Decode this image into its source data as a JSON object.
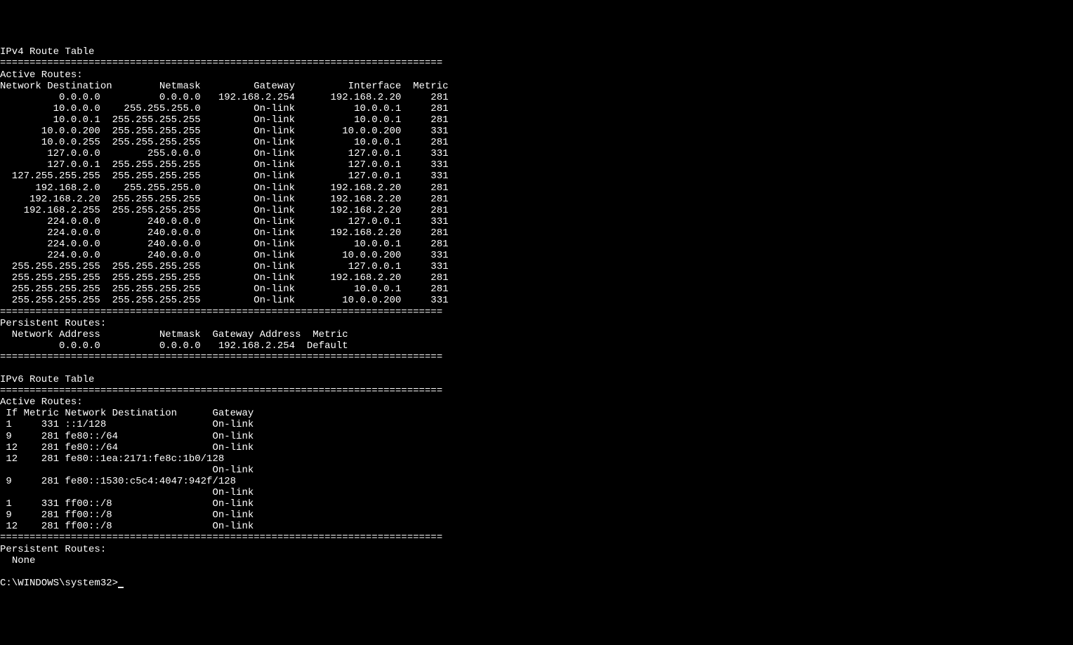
{
  "separator_short": "===========================================================================",
  "ipv4": {
    "title": "IPv4 Route Table",
    "active_header": "Active Routes:",
    "columns": {
      "network_destination": "Network Destination",
      "netmask": "Netmask",
      "gateway": "Gateway",
      "interface": "Interface",
      "metric": "Metric"
    },
    "routes": [
      {
        "dst": "0.0.0.0",
        "mask": "0.0.0.0",
        "gw": "192.168.2.254",
        "if": "192.168.2.20",
        "metric": "281"
      },
      {
        "dst": "10.0.0.0",
        "mask": "255.255.255.0",
        "gw": "On-link",
        "if": "10.0.0.1",
        "metric": "281"
      },
      {
        "dst": "10.0.0.1",
        "mask": "255.255.255.255",
        "gw": "On-link",
        "if": "10.0.0.1",
        "metric": "281"
      },
      {
        "dst": "10.0.0.200",
        "mask": "255.255.255.255",
        "gw": "On-link",
        "if": "10.0.0.200",
        "metric": "331"
      },
      {
        "dst": "10.0.0.255",
        "mask": "255.255.255.255",
        "gw": "On-link",
        "if": "10.0.0.1",
        "metric": "281"
      },
      {
        "dst": "127.0.0.0",
        "mask": "255.0.0.0",
        "gw": "On-link",
        "if": "127.0.0.1",
        "metric": "331"
      },
      {
        "dst": "127.0.0.1",
        "mask": "255.255.255.255",
        "gw": "On-link",
        "if": "127.0.0.1",
        "metric": "331"
      },
      {
        "dst": "127.255.255.255",
        "mask": "255.255.255.255",
        "gw": "On-link",
        "if": "127.0.0.1",
        "metric": "331"
      },
      {
        "dst": "192.168.2.0",
        "mask": "255.255.255.0",
        "gw": "On-link",
        "if": "192.168.2.20",
        "metric": "281"
      },
      {
        "dst": "192.168.2.20",
        "mask": "255.255.255.255",
        "gw": "On-link",
        "if": "192.168.2.20",
        "metric": "281"
      },
      {
        "dst": "192.168.2.255",
        "mask": "255.255.255.255",
        "gw": "On-link",
        "if": "192.168.2.20",
        "metric": "281"
      },
      {
        "dst": "224.0.0.0",
        "mask": "240.0.0.0",
        "gw": "On-link",
        "if": "127.0.0.1",
        "metric": "331"
      },
      {
        "dst": "224.0.0.0",
        "mask": "240.0.0.0",
        "gw": "On-link",
        "if": "192.168.2.20",
        "metric": "281"
      },
      {
        "dst": "224.0.0.0",
        "mask": "240.0.0.0",
        "gw": "On-link",
        "if": "10.0.0.1",
        "metric": "281"
      },
      {
        "dst": "224.0.0.0",
        "mask": "240.0.0.0",
        "gw": "On-link",
        "if": "10.0.0.200",
        "metric": "331"
      },
      {
        "dst": "255.255.255.255",
        "mask": "255.255.255.255",
        "gw": "On-link",
        "if": "127.0.0.1",
        "metric": "331"
      },
      {
        "dst": "255.255.255.255",
        "mask": "255.255.255.255",
        "gw": "On-link",
        "if": "192.168.2.20",
        "metric": "281"
      },
      {
        "dst": "255.255.255.255",
        "mask": "255.255.255.255",
        "gw": "On-link",
        "if": "10.0.0.1",
        "metric": "281"
      },
      {
        "dst": "255.255.255.255",
        "mask": "255.255.255.255",
        "gw": "On-link",
        "if": "10.0.0.200",
        "metric": "331"
      }
    ],
    "persistent_header": "Persistent Routes:",
    "persistent_columns": {
      "network_address": "Network Address",
      "netmask": "Netmask",
      "gateway_address": "Gateway Address",
      "metric": "Metric"
    },
    "persistent_routes": [
      {
        "addr": "0.0.0.0",
        "mask": "0.0.0.0",
        "gw": "192.168.2.254",
        "metric": "Default"
      }
    ]
  },
  "ipv6": {
    "title": "IPv6 Route Table",
    "active_header": "Active Routes:",
    "columns": {
      "if": "If",
      "metric": "Metric",
      "network_destination": "Network Destination",
      "gateway": "Gateway"
    },
    "routes": [
      {
        "if": "1",
        "metric": "331",
        "dst": "::1/128",
        "gw": "On-link",
        "wrap": false
      },
      {
        "if": "9",
        "metric": "281",
        "dst": "fe80::/64",
        "gw": "On-link",
        "wrap": false
      },
      {
        "if": "12",
        "metric": "281",
        "dst": "fe80::/64",
        "gw": "On-link",
        "wrap": false
      },
      {
        "if": "12",
        "metric": "281",
        "dst": "fe80::1ea:2171:fe8c:1b0/128",
        "gw": "On-link",
        "wrap": true
      },
      {
        "if": "9",
        "metric": "281",
        "dst": "fe80::1530:c5c4:4047:942f/128",
        "gw": "On-link",
        "wrap": true
      },
      {
        "if": "1",
        "metric": "331",
        "dst": "ff00::/8",
        "gw": "On-link",
        "wrap": false
      },
      {
        "if": "9",
        "metric": "281",
        "dst": "ff00::/8",
        "gw": "On-link",
        "wrap": false
      },
      {
        "if": "12",
        "metric": "281",
        "dst": "ff00::/8",
        "gw": "On-link",
        "wrap": false
      }
    ],
    "persistent_header": "Persistent Routes:",
    "persistent_none": "None"
  },
  "prompt": "C:\\WINDOWS\\system32>"
}
